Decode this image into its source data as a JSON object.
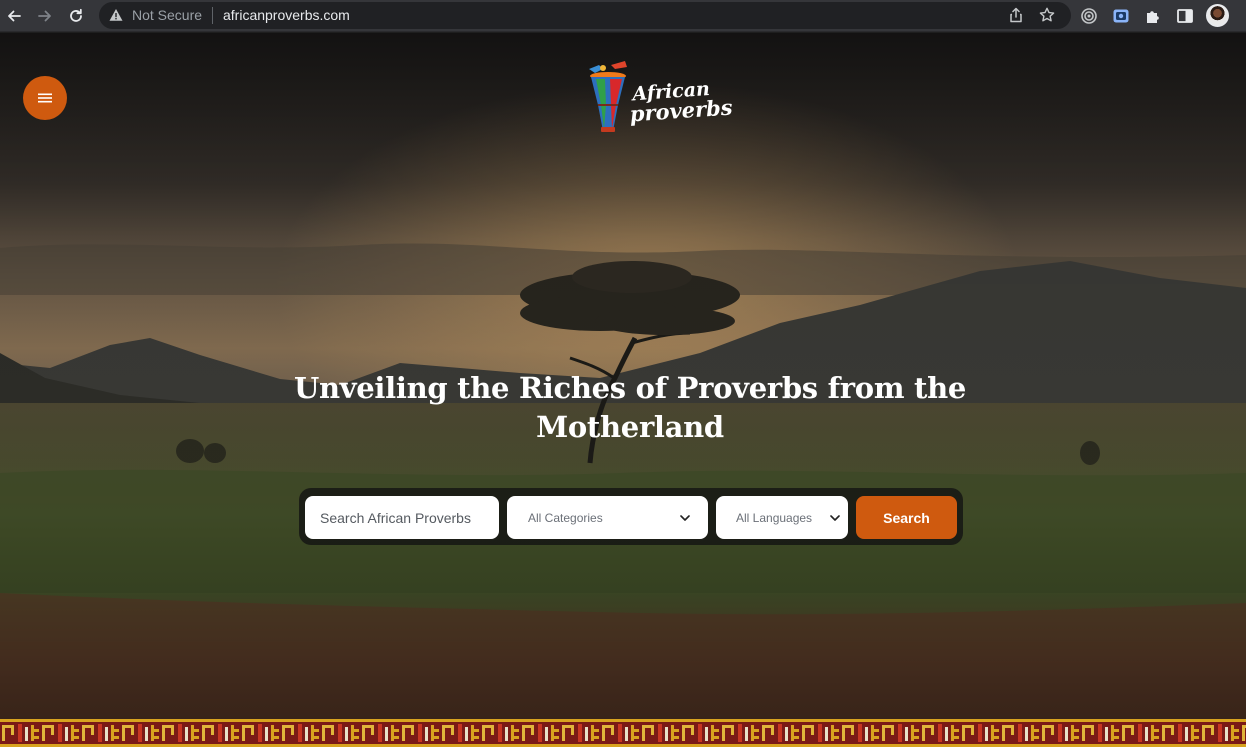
{
  "browser": {
    "security_label": "Not Secure",
    "url": "africanproverbs.com",
    "icons": [
      "back-arrow-icon",
      "forward-arrow-icon",
      "reload-icon",
      "warning-icon",
      "share-icon",
      "star-icon",
      "extension-target-icon",
      "extension-screen-icon",
      "puzzle-icon",
      "sidebar-icon",
      "profile-avatar"
    ]
  },
  "site": {
    "logo": {
      "line1": "African",
      "line2": "proverbs"
    },
    "menu_icon": "hamburger-icon",
    "accent_color": "#cf5a0f"
  },
  "hero": {
    "headline_line1": "Unveiling the Riches of Proverbs from the",
    "headline_line2": "Motherland"
  },
  "search": {
    "placeholder": "Search African Proverbs",
    "category_selected": "All Categories",
    "language_selected": "All Languages",
    "button_label": "Search"
  }
}
